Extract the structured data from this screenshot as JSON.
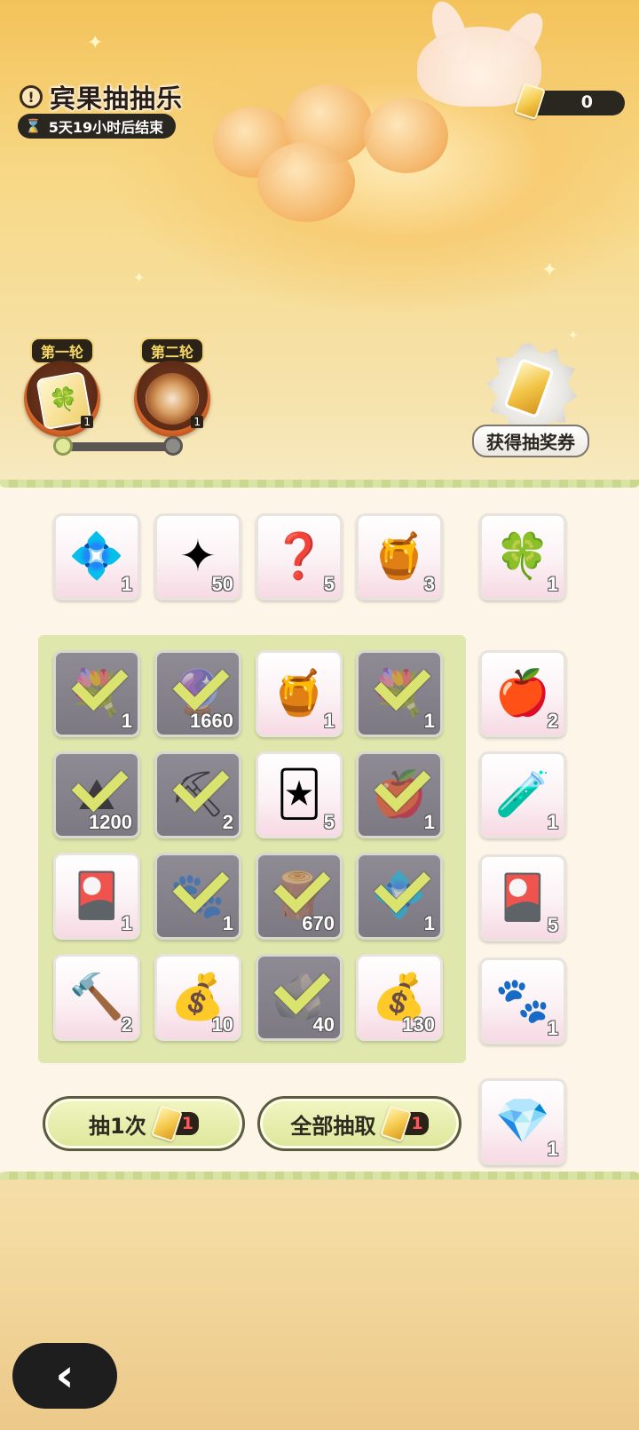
{
  "header": {
    "title": "宾果抽抽乐",
    "alert_glyph": "!",
    "timer_text": "5天19小时后结束",
    "ticket_balance": "0"
  },
  "rounds": [
    {
      "label": "第一轮",
      "reward_icon": "clover-card-icon",
      "count": "1",
      "state": "current"
    },
    {
      "label": "第二轮",
      "reward_icon": "takoyaki-icon",
      "count": "1",
      "state": "upcoming"
    }
  ],
  "get_ticket": {
    "label": "获得抽奖券"
  },
  "top_row": [
    {
      "icon": "blue-crystal-icon",
      "glyph": "💠",
      "qty": "1"
    },
    {
      "icon": "star-shard-icon",
      "glyph": "✦",
      "qty": "50"
    },
    {
      "icon": "mystery-character-icon",
      "glyph": "❓",
      "qty": "5"
    },
    {
      "icon": "honey-bottle-icon",
      "glyph": "🍯",
      "qty": "3"
    }
  ],
  "grid": [
    {
      "icon": "sunflower-bouquet-icon",
      "glyph": "💐",
      "qty": "1",
      "claimed": true
    },
    {
      "icon": "purple-orb-icon",
      "glyph": "🔮",
      "qty": "1660",
      "claimed": true
    },
    {
      "icon": "honey-bottle-icon",
      "glyph": "🍯",
      "qty": "1",
      "claimed": false
    },
    {
      "icon": "lavender-bouquet-icon",
      "glyph": "💐",
      "qty": "1",
      "claimed": true
    },
    {
      "icon": "soil-pile-icon",
      "glyph": "⛰",
      "qty": "1200",
      "claimed": true
    },
    {
      "icon": "pickaxe-icon",
      "glyph": "⛏",
      "qty": "2",
      "claimed": true
    },
    {
      "icon": "blue-character-card-icon",
      "glyph": "🃏",
      "qty": "5",
      "claimed": false
    },
    {
      "icon": "golden-apple-icon",
      "glyph": "🍎",
      "qty": "1",
      "claimed": true
    },
    {
      "icon": "gold-character-card-icon",
      "glyph": "🎴",
      "qty": "1",
      "claimed": false
    },
    {
      "icon": "paw-charm-icon",
      "glyph": "🐾",
      "qty": "1",
      "claimed": true
    },
    {
      "icon": "wood-logs-icon",
      "glyph": "🪵",
      "qty": "670",
      "claimed": true
    },
    {
      "icon": "blue-crystal-icon",
      "glyph": "💠",
      "qty": "1",
      "claimed": true
    },
    {
      "icon": "hammer-icon",
      "glyph": "🔨",
      "qty": "2",
      "claimed": false
    },
    {
      "icon": "pink-coin-bag-icon",
      "glyph": "💰",
      "qty": "10",
      "claimed": false
    },
    {
      "icon": "copper-ore-icon",
      "glyph": "🪨",
      "qty": "40",
      "claimed": true
    },
    {
      "icon": "brown-seed-bag-icon",
      "glyph": "💰",
      "qty": "130",
      "claimed": false
    }
  ],
  "side_column": [
    {
      "icon": "clover-card-icon",
      "glyph": "🍀",
      "qty": "1"
    },
    {
      "icon": "pink-apple-icon",
      "glyph": "🍎",
      "qty": "2"
    },
    {
      "icon": "potion-bottle-icon",
      "glyph": "🧪",
      "qty": "1"
    },
    {
      "icon": "purple-character-card-icon",
      "glyph": "🎴",
      "qty": "5"
    },
    {
      "icon": "paw-charm-icon",
      "glyph": "🐾",
      "qty": "1"
    },
    {
      "icon": "pink-crystal-icon",
      "glyph": "💎",
      "qty": "1"
    }
  ],
  "buttons": {
    "draw_once": {
      "label": "抽1次",
      "cost": "1"
    },
    "draw_all": {
      "label": "全部抽取",
      "cost": "1"
    },
    "back_glyph": "‹"
  },
  "colors": {
    "accent_green": "#dde69b",
    "cost_red": "#ff5560",
    "claimed_gray": "#8f8b94"
  }
}
